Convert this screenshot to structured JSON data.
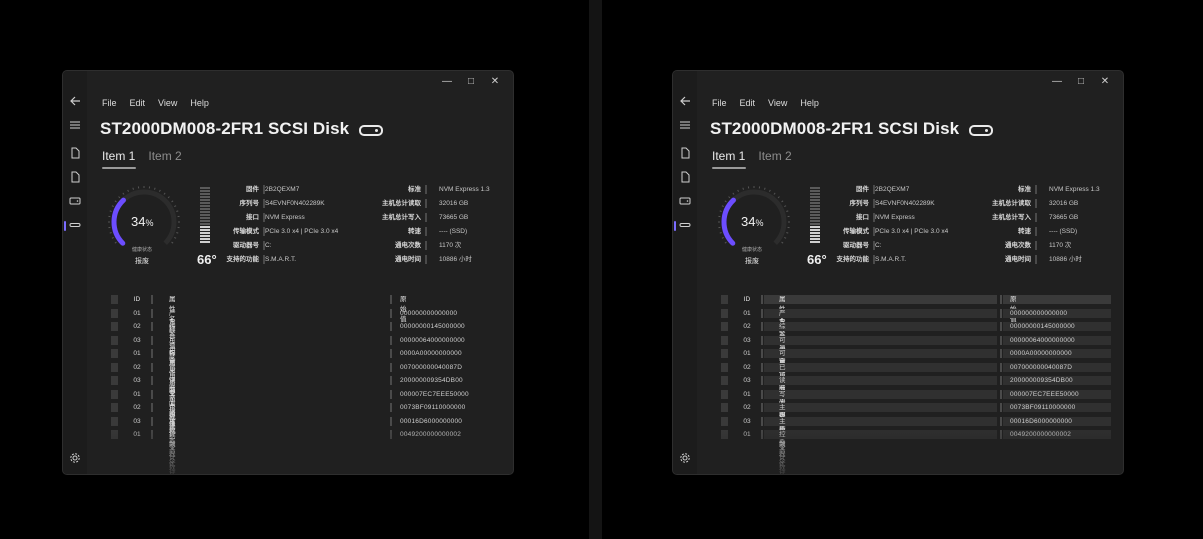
{
  "menu": [
    "File",
    "Edit",
    "View",
    "Help"
  ],
  "title": "ST2000DM008-2FR1 SCSI Disk",
  "tabs": [
    "Item 1",
    "Item 2"
  ],
  "health": {
    "percent": "34",
    "unit": "%",
    "label": "健康状态",
    "status": "报废",
    "fraction": 0.34
  },
  "temperature": {
    "value": "66°",
    "level": 0.33
  },
  "info_left": [
    {
      "k": "固件",
      "v": "2B2QEXM7"
    },
    {
      "k": "序列号",
      "v": "S4EVNF0N402289K"
    },
    {
      "k": "接口",
      "v": "NVM Express"
    },
    {
      "k": "传输模式",
      "v": "PCIe 3.0 x4 | PCIe 3.0 x4"
    },
    {
      "k": "驱动器号",
      "v": "C:"
    },
    {
      "k": "支持的功能",
      "v": "S.M.A.R.T."
    }
  ],
  "info_right": [
    {
      "k": "标准",
      "v": "NVM Express 1.3"
    },
    {
      "k": "主机总计读取",
      "v": "32016 GB"
    },
    {
      "k": "主机总计写入",
      "v": "73665 GB"
    },
    {
      "k": "转速",
      "v": "---- (SSD)"
    },
    {
      "k": "通电次数",
      "v": "1170 次"
    },
    {
      "k": "通电时间",
      "v": "10886 小时"
    }
  ],
  "table": {
    "headers": {
      "id": "ID",
      "name": "属性名称",
      "raw": "原始值"
    },
    "rows": [
      {
        "id": "01",
        "name": "严重警告标志",
        "raw": "000000000000000"
      },
      {
        "id": "02",
        "name": "综合温度",
        "raw": "00000000145000000"
      },
      {
        "id": "03",
        "name": "可用备用空间",
        "raw": "00000064000000000"
      },
      {
        "id": "01",
        "name": "可用备用空间阈值",
        "raw": "0000A00000000000"
      },
      {
        "id": "02",
        "name": "已用寿命百分比",
        "raw": "007000000040087D"
      },
      {
        "id": "03",
        "name": "读取单位计数",
        "raw": "200000009354DB00"
      },
      {
        "id": "01",
        "name": "写入单位计数",
        "raw": "000007EC7EEE50000"
      },
      {
        "id": "02",
        "name": "主机读命令计数",
        "raw": "0073BF09110000000"
      },
      {
        "id": "03",
        "name": "主机写命令计数",
        "raw": "00016D6000000000"
      },
      {
        "id": "01",
        "name": "控制器忙状态时间",
        "raw": "0049200000000002"
      }
    ]
  },
  "window_controls": [
    "minimize-icon",
    "maximize-icon",
    "close-icon"
  ],
  "colors": {
    "accent": "#6c4dff",
    "background": "#202020"
  }
}
